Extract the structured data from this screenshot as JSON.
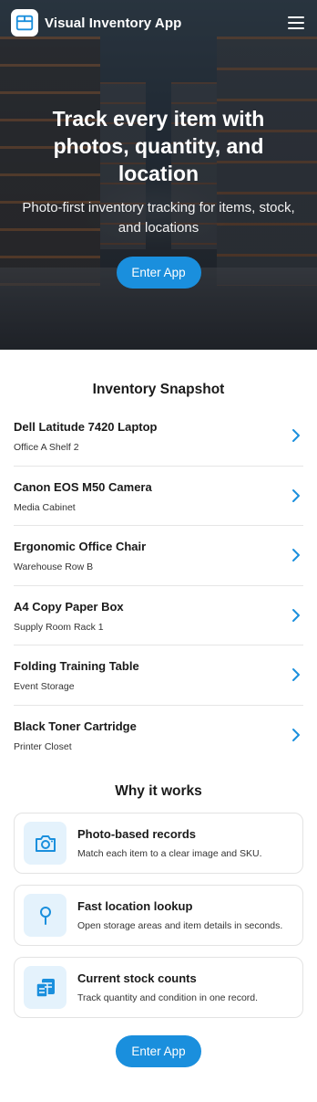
{
  "app": {
    "name": "Visual Inventory App"
  },
  "hero": {
    "title": "Track every item with photos, quantity, and location",
    "subtitle": "Photo-first inventory tracking for items, stock, and locations",
    "cta_label": "Enter App"
  },
  "snapshot": {
    "title": "Inventory Snapshot",
    "items": [
      {
        "name": "Dell Latitude 7420 Laptop",
        "location": "Office A Shelf 2"
      },
      {
        "name": "Canon EOS M50 Camera",
        "location": "Media Cabinet"
      },
      {
        "name": "Ergonomic Office Chair",
        "location": "Warehouse Row B"
      },
      {
        "name": "A4 Copy Paper Box",
        "location": "Supply Room Rack 1"
      },
      {
        "name": "Folding Training Table",
        "location": "Event Storage"
      },
      {
        "name": "Black Toner Cartridge",
        "location": "Printer Closet"
      }
    ]
  },
  "why": {
    "title": "Why it works",
    "cards": [
      {
        "icon": "camera-icon",
        "title": "Photo-based records",
        "desc": "Match each item to a clear image and SKU."
      },
      {
        "icon": "location-pin-icon",
        "title": "Fast location lookup",
        "desc": "Open storage areas and item details in seconds."
      },
      {
        "icon": "stock-list-icon",
        "title": "Current stock counts",
        "desc": "Track quantity and condition in one record."
      }
    ]
  },
  "footer": {
    "cta_label": "Enter App"
  },
  "colors": {
    "accent": "#1a8fdd",
    "icon_bg": "#e4f2fc"
  }
}
